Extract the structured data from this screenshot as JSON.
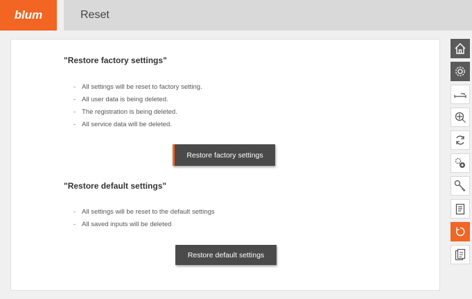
{
  "header": {
    "logo_text": "blum",
    "title": "Reset"
  },
  "factory": {
    "title": "\"Restore factory settings\"",
    "items": [
      "All settings will be reset to factory setting.",
      "All user data is being deleted.",
      "The registration is being deleted.",
      "All service data will be deleted."
    ],
    "button_label": "Restore factory settings"
  },
  "default": {
    "title": "\"Restore default settings\"",
    "items": [
      "All settings will be reset to the default settings",
      "All saved inputs will be deleted"
    ],
    "button_label": "Restore default settings"
  },
  "sidebar": {
    "items": [
      {
        "icon": "home-icon",
        "state": "dark"
      },
      {
        "icon": "gear-icon",
        "state": "dark"
      },
      {
        "icon": "drawer-slide-icon",
        "state": "normal"
      },
      {
        "icon": "zoom-target-icon",
        "state": "normal"
      },
      {
        "icon": "sync-icon",
        "state": "normal"
      },
      {
        "icon": "double-gear-icon",
        "state": "normal"
      },
      {
        "icon": "key-icon",
        "state": "normal"
      },
      {
        "icon": "clipboard-icon",
        "state": "normal"
      },
      {
        "icon": "reset-icon",
        "state": "active"
      },
      {
        "icon": "document-info-icon",
        "state": "normal"
      }
    ]
  },
  "colors": {
    "accent": "#f26522",
    "button": "#4a4a4a",
    "header": "#d9d9d9"
  }
}
